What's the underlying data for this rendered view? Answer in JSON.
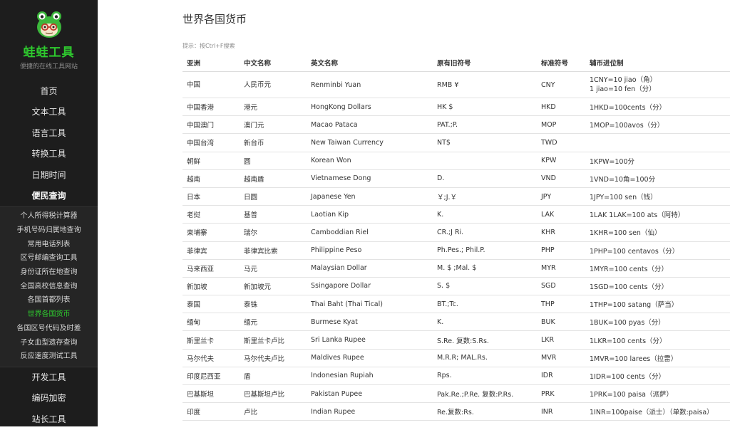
{
  "sidebar": {
    "brand": "蛙蛙工具",
    "tagline": "便捷的在线工具网站",
    "nav_top": [
      "首页",
      "文本工具",
      "语言工具",
      "转换工具",
      "日期时间",
      "便民查询"
    ],
    "sub_items": [
      "个人所得税计算器",
      "手机号码归属地查询",
      "常用电话列表",
      "区号邮编查询工具",
      "身份证所在地查询",
      "全国高校信息查询",
      "各国首都列表",
      "世界各国货币",
      "各国区号代码及时差",
      "子女血型遗存查询",
      "反应速度测试工具"
    ],
    "nav_bottom": [
      "开发工具",
      "编码加密",
      "站长工具"
    ],
    "colors": {
      "background": "#1d1d1d",
      "accent": "#2ec92e"
    }
  },
  "main": {
    "title": "世界各国货币",
    "hint": "提示：按Ctrl+F搜索"
  },
  "table": {
    "headers": [
      "亚洲",
      "中文名称",
      "英文名称",
      "原有旧符号",
      "标准符号",
      "辅币进位制"
    ],
    "rows": [
      [
        "中国",
        "人民币元",
        "Renminbi Yuan",
        "RMB ¥",
        "CNY",
        "1CNY=10 jiao（角）\n1 jiao=10 fen（分）"
      ],
      [
        "中国香港",
        "港元",
        "HongKong Dollars",
        "HK $",
        "HKD",
        "1HKD=100cents（分）"
      ],
      [
        "中国澳门",
        "澳门元",
        "Macao Pataca",
        "PAT.;P.",
        "MOP",
        "1MOP=100avos（分）"
      ],
      [
        "中国台湾",
        "新台币",
        "New Taiwan Currency",
        "NT$",
        "TWD",
        ""
      ],
      [
        "朝鲜",
        "圆",
        "Korean Won",
        "",
        "KPW",
        "1KPW=100分"
      ],
      [
        "越南",
        "越南盾",
        "Vietnamese Dong",
        "D.",
        "VND",
        "1VND=10角=100分"
      ],
      [
        "日本",
        "日圆",
        "Japanese Yen",
        "￥;J.￥",
        "JPY",
        "1JPY=100 sen（钱）"
      ],
      [
        "老挝",
        "基普",
        "Laotian Kip",
        "K.",
        "LAK",
        "1LAK 1LAK=100 ats（阿特）"
      ],
      [
        "柬埔寨",
        "瑞尔",
        "Camboddian Riel",
        "CR.;J Ri.",
        "KHR",
        "1KHR=100 sen（仙）"
      ],
      [
        "菲律宾",
        "菲律宾比索",
        "Philippine Peso",
        "Ph.Pes.; Phil.P.",
        "PHP",
        "1PHP=100 centavos（分）"
      ],
      [
        "马来西亚",
        "马元",
        "Malaysian Dollar",
        "M. $ ;Mal. $",
        "MYR",
        "1MYR=100 cents（分）"
      ],
      [
        "新加坡",
        "新加坡元",
        "Ssingapore Dollar",
        "S. $",
        "SGD",
        "1SGD=100 cents（分）"
      ],
      [
        "泰国",
        "泰铢",
        "Thai Baht (Thai Tical)",
        "BT.;Tc.",
        "THP",
        "1THP=100 satang（萨当）"
      ],
      [
        "缅甸",
        "缅元",
        "Burmese Kyat",
        "K.",
        "BUK",
        "1BUK=100 pyas（分）"
      ],
      [
        "斯里兰卡",
        "斯里兰卡卢比",
        "Sri Lanka Rupee",
        "S.Re. 复数:S.Rs.",
        "LKR",
        "1LKR=100 cents（分）"
      ],
      [
        "马尔代夫",
        "马尔代夫卢比",
        "Maldives Rupee",
        "M.R.R; MAL.Rs.",
        "MVR",
        "1MVR=100 larees（拉雷）"
      ],
      [
        "印度尼西亚",
        "盾",
        "Indonesian Rupiah",
        "Rps.",
        "IDR",
        "1IDR=100 cents（分）"
      ],
      [
        "巴基斯坦",
        "巴基斯坦卢比",
        "Pakistan Pupee",
        "Pak.Re.;P.Re. 复数:P.Rs.",
        "PRK",
        "1PRK=100 paisa（派萨）"
      ],
      [
        "印度",
        "卢比",
        "Indian Rupee",
        "Re.复数:Rs.",
        "INR",
        "1INR=100paise（派士）（单数:paisa）"
      ]
    ]
  }
}
